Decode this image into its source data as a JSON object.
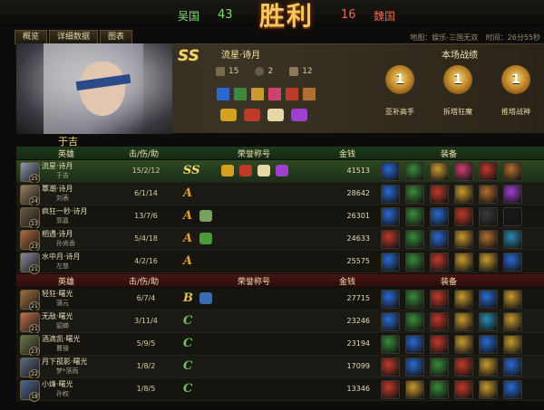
{
  "header": {
    "wu_name": "吴国",
    "wu_score": "43",
    "victory_text": "胜利",
    "wei_score": "16",
    "wei_name": "魏国"
  },
  "tabs": [
    "概览",
    "详细数据",
    "图表"
  ],
  "map_info": {
    "map": "地图：娱乐-三国无双",
    "time": "时间：26分55秒"
  },
  "featured": {
    "grade": "SS",
    "name": "流星·诗月",
    "stats": [
      "15",
      "2",
      "12"
    ],
    "battle_title": "本场战绩",
    "badges": [
      {
        "rank": "1",
        "label": "亚补高手"
      },
      {
        "rank": "1",
        "label": "拆塔狂魔"
      },
      {
        "rank": "1",
        "label": "推塔战神"
      }
    ]
  },
  "player_tag": "于吉",
  "columns": {
    "hero": "英雄",
    "kda": "击/伤/助",
    "honor": "荣誉称号",
    "gold": "金钱",
    "equip": "装备"
  },
  "team_blue": [
    {
      "hero": "流星·诗月",
      "player": "于吉",
      "level": "25",
      "kda": "15/2/12",
      "grade": "SS",
      "gold": "41513",
      "av_color": "#8a9ab8",
      "titles": [
        "#d4a020",
        "#c03a2a",
        "#e8d8a8",
        "#a040d0"
      ],
      "equip": [
        "#2a6ad0",
        "#3a8a3a",
        "#c89a30",
        "#d04070",
        "#c03a2a",
        "#b07030"
      ]
    },
    {
      "hero": "覃潮·诗月",
      "player": "刘表",
      "level": "24",
      "kda": "6/1/14",
      "grade": "A",
      "gold": "28642",
      "av_color": "#9a8060",
      "titles": [],
      "equip": [
        "#2a6ad0",
        "#3a8a3a",
        "#c03a2a",
        "#c89a30",
        "#b07030",
        "#a040d0"
      ]
    },
    {
      "hero": "疯狂一秒·诗月",
      "player": "郭嘉",
      "level": "23",
      "kda": "13/7/6",
      "grade": "A",
      "gold": "26301",
      "av_color": "#6a5a48",
      "titles": [
        "#7aa060"
      ],
      "equip": [
        "#2a6ad0",
        "#3a8a3a",
        "#2a6ad0",
        "#c03a2a",
        "#3a3a3a",
        "#1a1a1a"
      ]
    },
    {
      "hero": "相遇·诗月",
      "player": "孙尚香",
      "level": "23",
      "kda": "5/4/18",
      "grade": "A",
      "gold": "24633",
      "av_color": "#b06a40",
      "titles": [
        "#4a9a3a"
      ],
      "equip": [
        "#c03a2a",
        "#3a8a3a",
        "#2a6ad0",
        "#c89a30",
        "#b07030",
        "#2a8ab0"
      ]
    },
    {
      "hero": "水中月·诗月",
      "player": "左慈",
      "level": "21",
      "kda": "4/2/16",
      "grade": "A",
      "gold": "25575",
      "av_color": "#8a8aa0",
      "titles": [],
      "equip": [
        "#2a6ad0",
        "#3a8a3a",
        "#c03a2a",
        "#c89a30",
        "#c89a30",
        "#2a6ad0"
      ]
    }
  ],
  "team_red": [
    {
      "hero": "轻狂·曙光",
      "player": "蒲元",
      "level": "21",
      "kda": "6/7/4",
      "grade": "B",
      "gold": "27715",
      "av_color": "#a07040",
      "titles": [
        "#3a6ab0"
      ],
      "equip": [
        "#2a6ad0",
        "#3a8a3a",
        "#c03a2a",
        "#c89a30",
        "#2a6ad0",
        "#c89a30"
      ]
    },
    {
      "hero": "无敌·曙光",
      "player": "貂蝉",
      "level": "21",
      "kda": "3/11/4",
      "grade": "C",
      "gold": "23246",
      "av_color": "#c07050",
      "titles": [],
      "equip": [
        "#2a6ad0",
        "#3a8a3a",
        "#c03a2a",
        "#c89a30",
        "#2a8ab0",
        "#c89a30"
      ]
    },
    {
      "hero": "酒滴凯·曙光",
      "player": "曹操",
      "level": "23",
      "kda": "5/9/5",
      "grade": "C",
      "gold": "23194",
      "av_color": "#6a7a48",
      "titles": [],
      "equip": [
        "#3a8a3a",
        "#2a6ad0",
        "#c03a2a",
        "#c89a30",
        "#2a6ad0",
        "#c89a30"
      ]
    },
    {
      "hero": "月下孤影·曙光",
      "player": "梦*落雨",
      "level": "22",
      "kda": "1/8/2",
      "grade": "C",
      "gold": "17099",
      "av_color": "#5a6a8a",
      "titles": [],
      "equip": [
        "#c03a2a",
        "#2a6ad0",
        "#3a8a3a",
        "#c03a2a",
        "#c89a30",
        "#2a6ad0"
      ]
    },
    {
      "hero": "小烽·曙光",
      "player": "孙权",
      "level": "18",
      "kda": "1/8/5",
      "grade": "C",
      "gold": "13346",
      "av_color": "#4a6a9a",
      "titles": [],
      "equip": [
        "#c03a2a",
        "#c89a30",
        "#3a8a3a",
        "#c03a2a",
        "#c89a30",
        "#2a6ad0"
      ]
    }
  ]
}
